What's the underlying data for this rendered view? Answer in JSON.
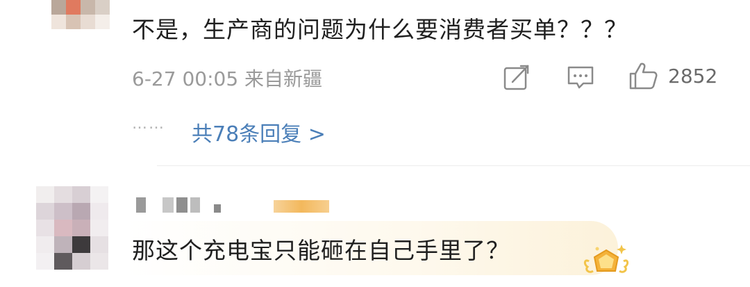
{
  "comments": [
    {
      "text": "不是，生产商的问题为什么要消费者买单？？？",
      "date": "6-27 00:05",
      "location": "来自新疆",
      "likes": "2852",
      "replies_label": "共78条回复 >",
      "more_dots": "……"
    },
    {
      "text": "那这个充电宝只能砸在自己手里了？"
    }
  ],
  "icons": {
    "share": "share-edit-icon",
    "comment": "comment-bubble-icon",
    "like": "thumbs-up-icon",
    "badge": "crown-medal-icon"
  },
  "colors": {
    "link": "#4b7fb8",
    "meta": "#9a9a9a",
    "text": "#1f1f1f",
    "badge": "#f3b85c"
  }
}
